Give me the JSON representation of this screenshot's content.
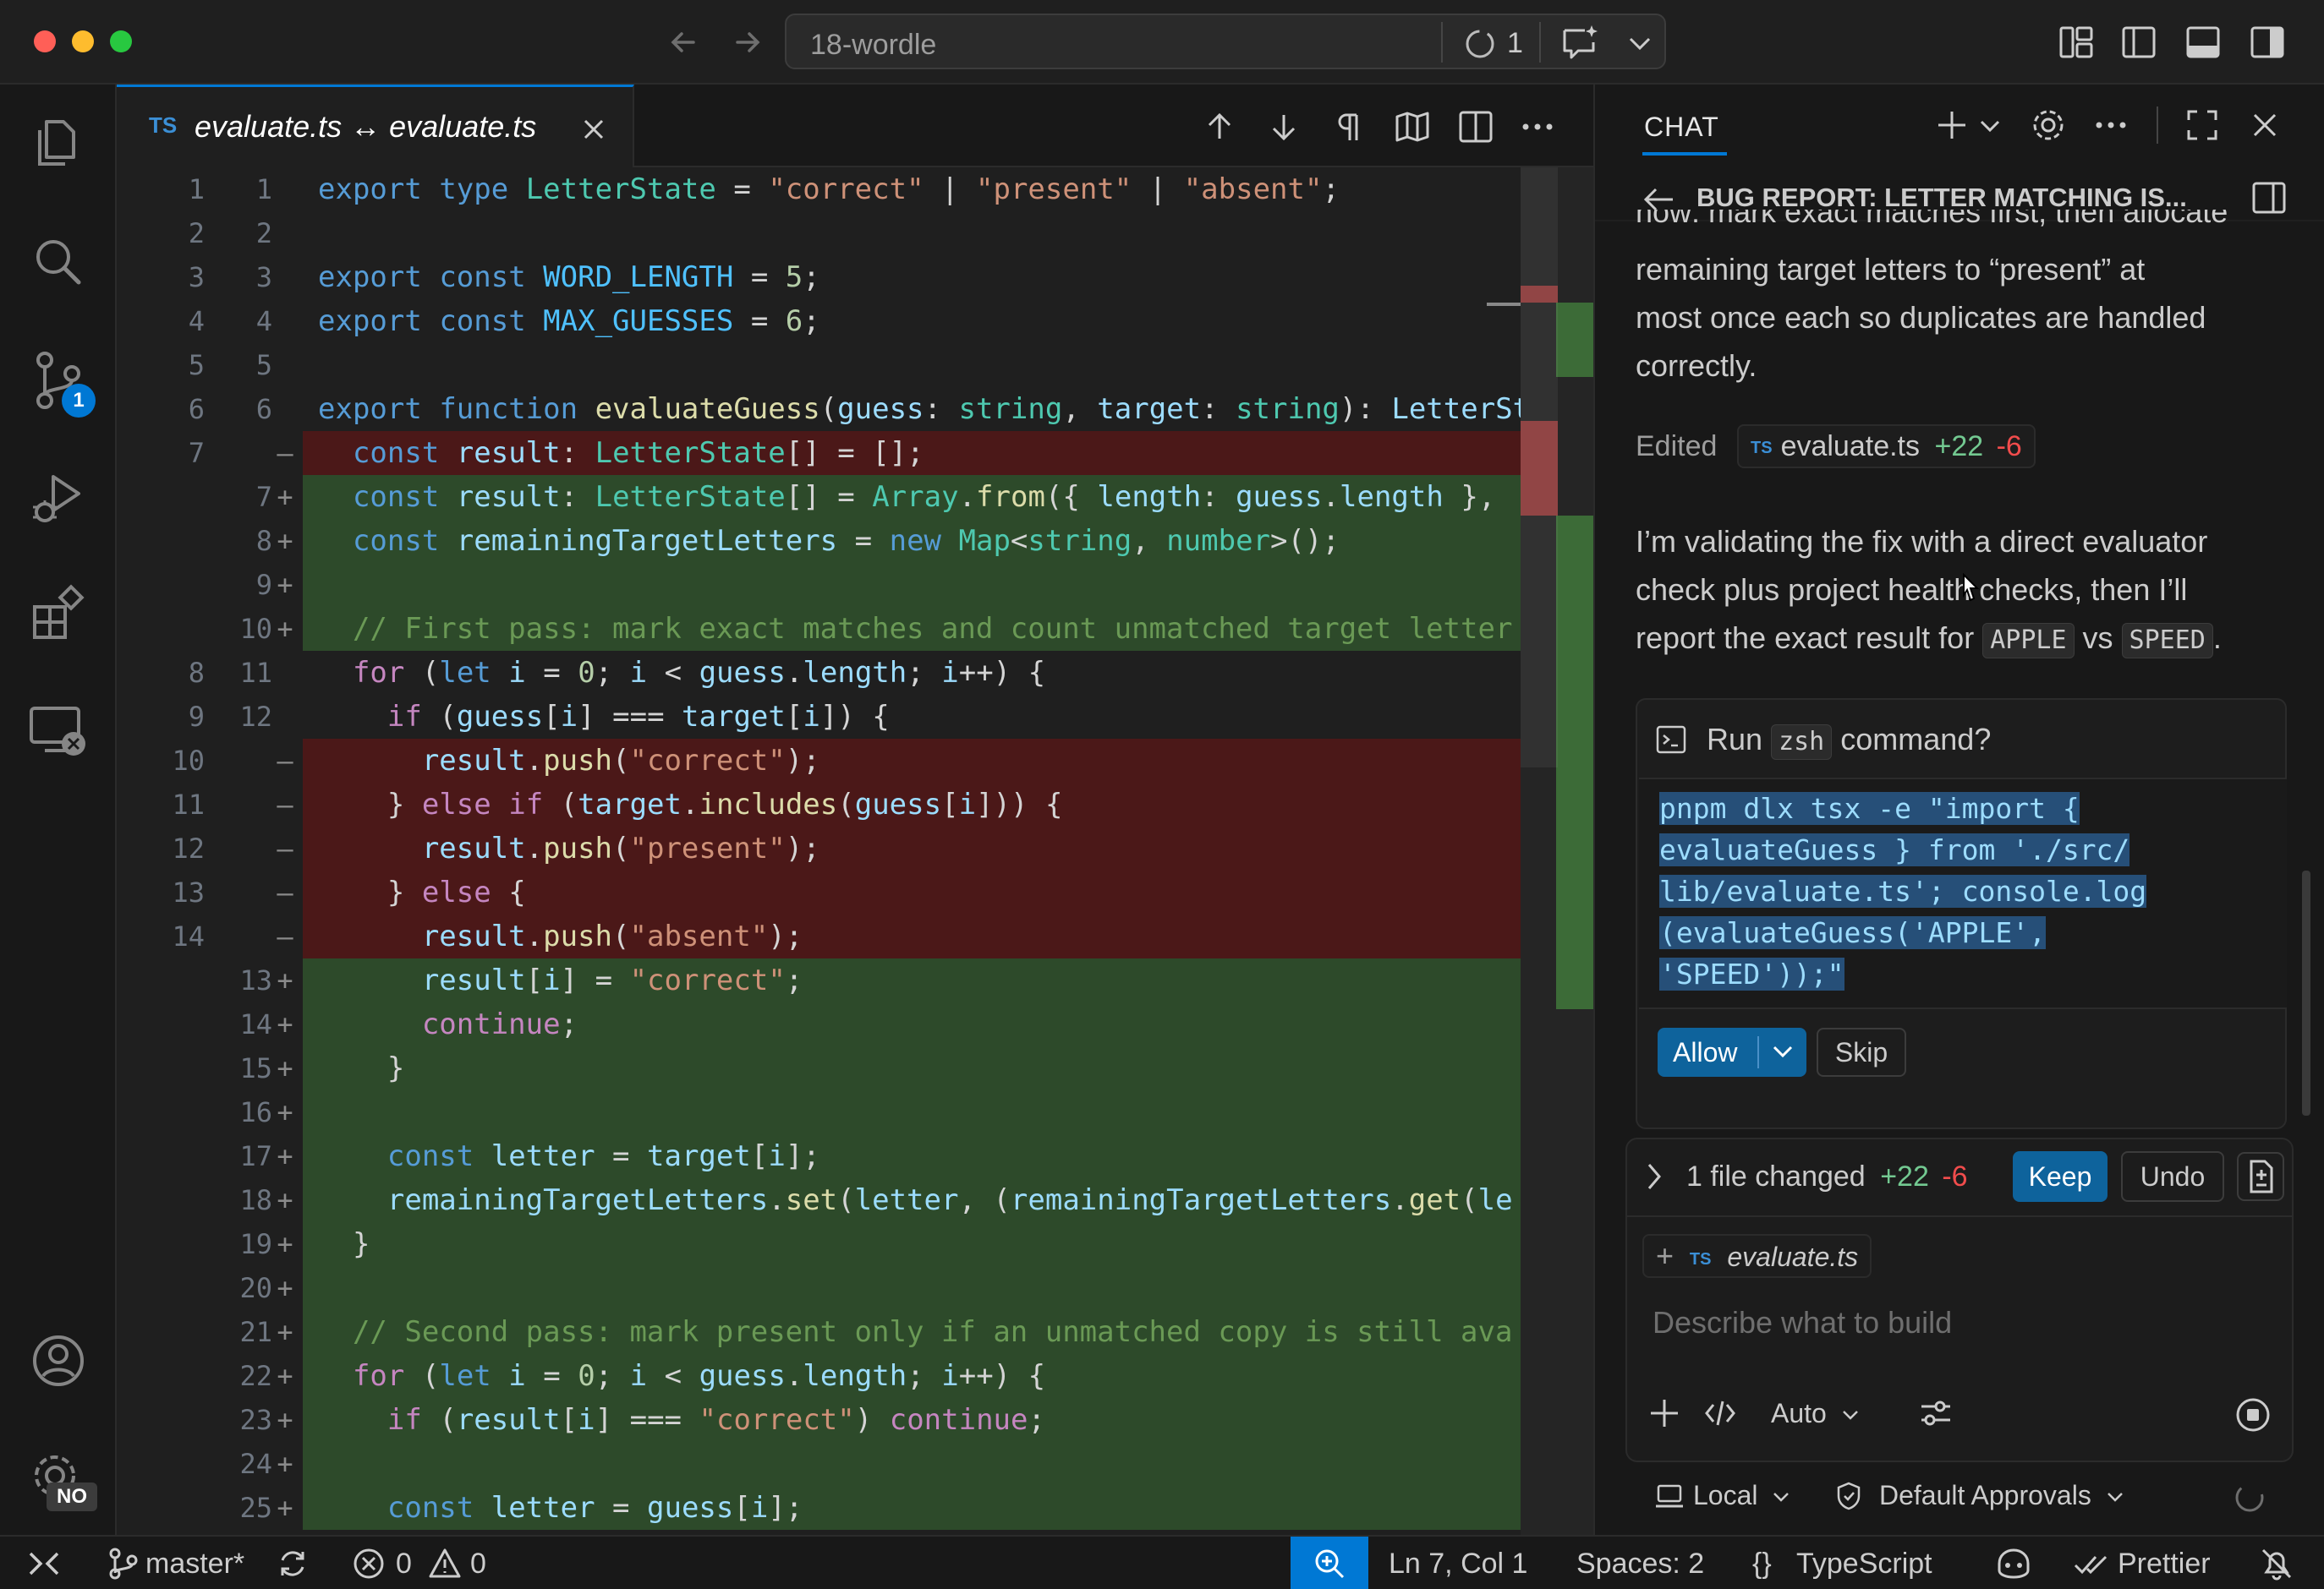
{
  "window": {
    "title": "18-wordle",
    "agent_count": "1"
  },
  "activity": {
    "scm_badge": "1",
    "settings_badge": "NO"
  },
  "tab": {
    "lang": "TS",
    "title": "evaluate.ts ↔ evaluate.ts"
  },
  "code": {
    "gutter": [
      {
        "old": "1",
        "new": "1",
        "mark": ""
      },
      {
        "old": "2",
        "new": "2",
        "mark": ""
      },
      {
        "old": "3",
        "new": "3",
        "mark": ""
      },
      {
        "old": "4",
        "new": "4",
        "mark": ""
      },
      {
        "old": "5",
        "new": "5",
        "mark": ""
      },
      {
        "old": "6",
        "new": "6",
        "mark": ""
      },
      {
        "old": "7",
        "new": "",
        "mark": "—"
      },
      {
        "old": "",
        "new": "7",
        "mark": "+"
      },
      {
        "old": "",
        "new": "8",
        "mark": "+"
      },
      {
        "old": "",
        "new": "9",
        "mark": "+"
      },
      {
        "old": "",
        "new": "10",
        "mark": "+"
      },
      {
        "old": "8",
        "new": "11",
        "mark": ""
      },
      {
        "old": "9",
        "new": "12",
        "mark": ""
      },
      {
        "old": "10",
        "new": "",
        "mark": "—"
      },
      {
        "old": "11",
        "new": "",
        "mark": "—"
      },
      {
        "old": "12",
        "new": "",
        "mark": "—"
      },
      {
        "old": "13",
        "new": "",
        "mark": "—"
      },
      {
        "old": "14",
        "new": "",
        "mark": "—"
      },
      {
        "old": "",
        "new": "13",
        "mark": "+"
      },
      {
        "old": "",
        "new": "14",
        "mark": "+"
      },
      {
        "old": "",
        "new": "15",
        "mark": "+"
      },
      {
        "old": "",
        "new": "16",
        "mark": "+"
      },
      {
        "old": "",
        "new": "17",
        "mark": "+"
      },
      {
        "old": "",
        "new": "18",
        "mark": "+"
      },
      {
        "old": "",
        "new": "19",
        "mark": "+"
      },
      {
        "old": "",
        "new": "20",
        "mark": "+"
      },
      {
        "old": "",
        "new": "21",
        "mark": "+"
      },
      {
        "old": "",
        "new": "22",
        "mark": "+"
      },
      {
        "old": "",
        "new": "23",
        "mark": "+"
      },
      {
        "old": "",
        "new": "24",
        "mark": "+"
      },
      {
        "old": "",
        "new": "25",
        "mark": "+"
      }
    ],
    "lines": [
      "export type LetterState = \"correct\" | \"present\" | \"absent\";",
      "",
      "export const WORD_LENGTH = 5;",
      "export const MAX_GUESSES = 6;",
      "",
      "export function evaluateGuess(guess: string, target: string): LetterSt",
      "  const result: LetterState[] = [];",
      "  const result: LetterState[] = Array.from({ length: guess.length },",
      "  const remainingTargetLetters = new Map<string, number>();",
      "",
      "  // First pass: mark exact matches and count unmatched target letter",
      "  for (let i = 0; i < guess.length; i++) {",
      "    if (guess[i] === target[i]) {",
      "      result.push(\"correct\");",
      "    } else if (target.includes(guess[i])) {",
      "      result.push(\"present\");",
      "    } else {",
      "      result.push(\"absent\");",
      "      result[i] = \"correct\";",
      "      continue;",
      "    }",
      "",
      "    const letter = target[i];",
      "    remainingTargetLetters.set(letter, (remainingTargetLetters.get(le",
      "  }",
      "",
      "  // Second pass: mark present only if an unmatched copy is still ava",
      "  for (let i = 0; i < guess.length; i++) {",
      "    if (result[i] === \"correct\") continue;",
      "",
      "    const letter = guess[i];"
    ]
  },
  "chat": {
    "header": "CHAT",
    "thread_title": "BUG REPORT: LETTER MATCHING IS...",
    "paragraph1_cut": "now: mark exact matches first, then allocate",
    "paragraph1": [
      "remaining target letters to “present” at",
      "most once each so duplicates are handled",
      "correctly."
    ],
    "edited_label": "Edited",
    "edited_lang": "TS",
    "edited_file": "evaluate.ts",
    "edited_added": "+22",
    "edited_removed": "-6",
    "paragraph2_l1": "I’m validating the fix with a direct evaluator",
    "paragraph2_l2": "check plus project health checks, then I’ll",
    "paragraph2_l3a": "report the exact result for",
    "paragraph2_code1": "APPLE",
    "paragraph2_vs": "vs",
    "paragraph2_code2": "SPEED",
    "paragraph2_end": ".",
    "run_prefix": "Run",
    "run_shell": "zsh",
    "run_suffix": "command?",
    "command_lines": [
      "pnpm dlx tsx -e \"import {",
      "evaluateGuess } from './src/",
      "lib/evaluate.ts'; console.log",
      "(evaluateGuess('APPLE',",
      "'SPEED'));\""
    ],
    "allow_label": "Allow",
    "skip_label": "Skip",
    "files_changed": "1 file changed",
    "files_added": "+22",
    "files_removed": "-6",
    "keep_label": "Keep",
    "undo_label": "Undo",
    "attachment_lang": "TS",
    "attachment_file": "evaluate.ts",
    "input_placeholder": "Describe what to build",
    "mode": "Auto",
    "location": "Local",
    "approvals": "Default Approvals"
  },
  "status": {
    "branch": "master*",
    "errors": "0",
    "warnings": "0",
    "position": "Ln 7, Col 1",
    "spaces": "Spaces: 2",
    "language": "TypeScript",
    "formatter": "Prettier"
  },
  "colors": {
    "accent": "#0078d4",
    "added": "#2d4a2a",
    "removed": "#4b1818",
    "diff_added_text": "#73c991",
    "diff_removed_text": "#f14c4c"
  }
}
